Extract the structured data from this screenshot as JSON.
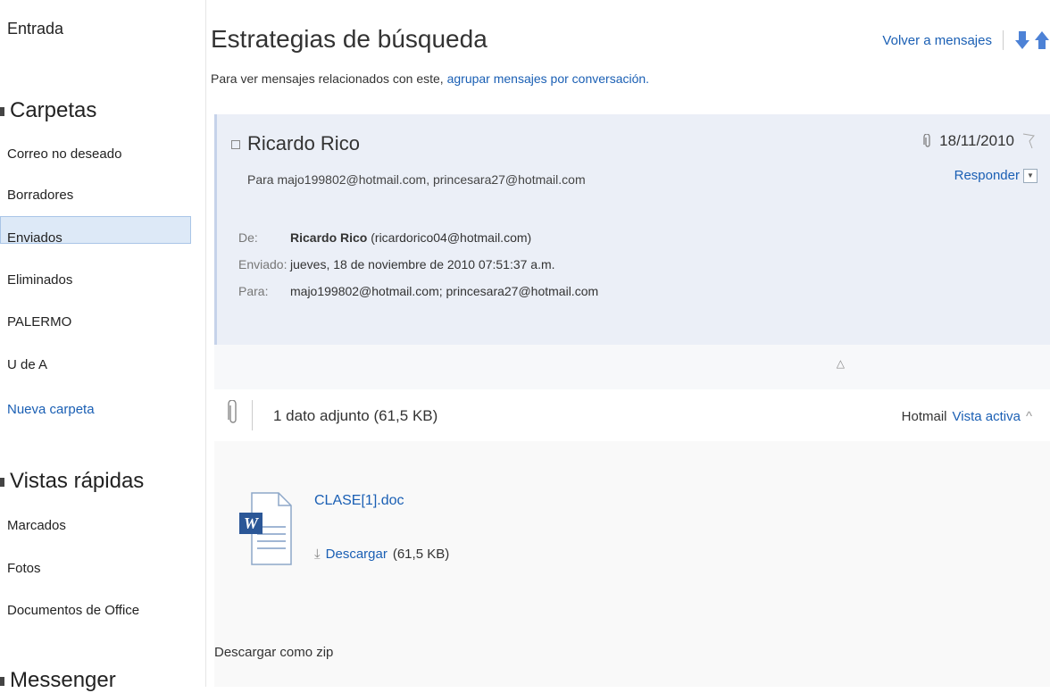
{
  "sidebar": {
    "inbox": "Entrada",
    "folders_header": "Carpetas",
    "folders": [
      "Correo no deseado",
      "Borradores",
      "Enviados",
      "Eliminados",
      "PALERMO",
      "U de A"
    ],
    "new_folder": "Nueva carpeta",
    "quick_views_header": "Vistas rápidas",
    "quick_views": [
      "Marcados",
      "Fotos",
      "Documentos de Office"
    ],
    "messenger_header": "Messenger"
  },
  "main": {
    "title": "Estrategias de búsqueda",
    "subtitle_prefix": "Para ver mensajes relacionados con este, ",
    "subtitle_link": "agrupar mensajes por conversación.",
    "back_link": "Volver a mensajes"
  },
  "message": {
    "sender": "Ricardo Rico",
    "recipients_line": "Para majo199802@hotmail.com, princesara27@hotmail.com",
    "date": "18/11/2010",
    "reply": "Responder",
    "from_label": "De:",
    "from_name": "Ricardo Rico",
    "from_email": " (ricardorico04@hotmail.com)",
    "sent_label": "Enviado:",
    "sent_value": "jueves, 18 de noviembre de 2010 07:51:37 a.m.",
    "to_label": "Para:",
    "to_value": "majo199802@hotmail.com; princesara27@hotmail.com"
  },
  "attachments": {
    "summary": "1 dato adjunto (61,5 KB)",
    "hotmail_label": "Hotmail",
    "active_view": "Vista activa",
    "file_name": "CLASE[1].doc",
    "download": "Descargar",
    "size": "(61,5 KB)",
    "zip": "Descargar como zip"
  },
  "colors": {
    "link": "#1a5fb4",
    "header_bg": "#ebeff7",
    "selected_bg": "#dde9f7"
  }
}
